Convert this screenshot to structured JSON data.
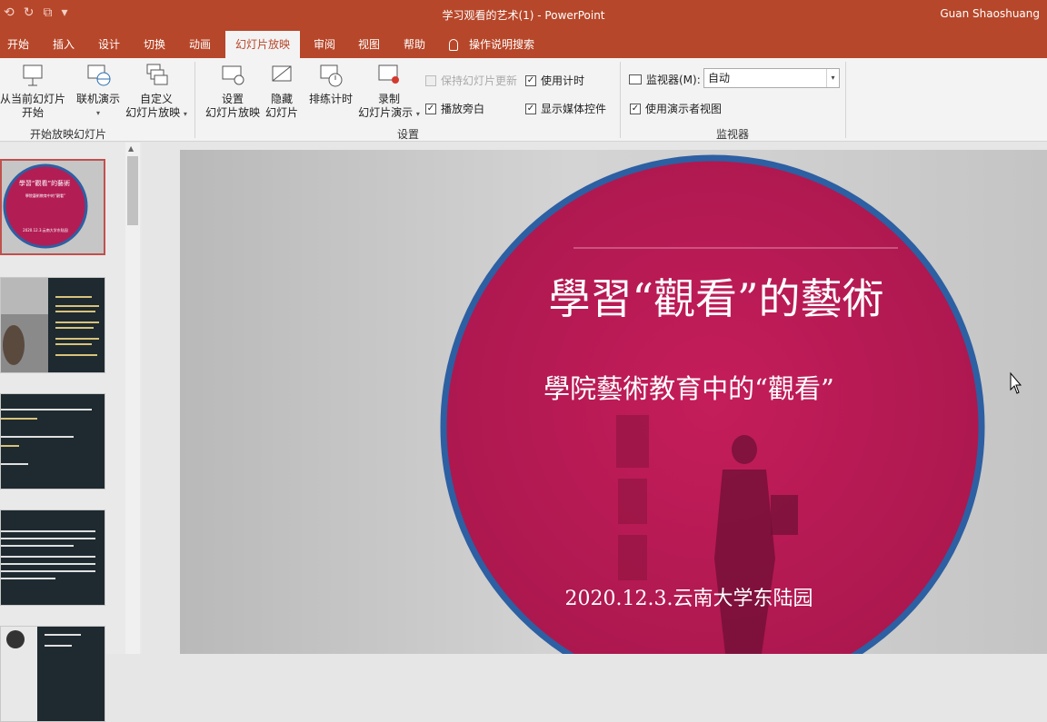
{
  "titlebar": {
    "doc_title": "学习观看的艺术(1)  -  PowerPoint",
    "user": "Guan Shaoshuang",
    "qat": [
      "⟲",
      "↻",
      "⧉",
      "▾"
    ]
  },
  "tabs": [
    "开始",
    "插入",
    "设计",
    "切换",
    "动画",
    "幻灯片放映",
    "审阅",
    "视图",
    "帮助",
    "操作说明搜索"
  ],
  "ribbon": {
    "start": {
      "from_current": "从当前幻灯片",
      "from_current_2": "开始",
      "online": "联机演示",
      "custom": "自定义",
      "custom_2": "幻灯片放映",
      "group_label": "开始放映幻灯片"
    },
    "setup": {
      "setup_show": "设置",
      "setup_show_2": "幻灯片放映",
      "hide": "隐藏",
      "hide_2": "幻灯片",
      "rehearse": "排练计时",
      "record": "录制",
      "record_2": "幻灯片演示",
      "keep_updated": "保持幻灯片更新",
      "play_narrations": "播放旁白",
      "use_timings": "使用计时",
      "show_media": "显示媒体控件",
      "group_label": "设置"
    },
    "monitors": {
      "monitor_label": "监视器(M):",
      "monitor_value": "自动",
      "presenter_view": "使用演示者视图",
      "group_label": "监视器"
    }
  },
  "slide": {
    "title": "學習“觀看”的藝術",
    "subtitle": "學院藝術教育中的“觀看”",
    "date": "2020.12.3.云南大学东陆园"
  },
  "thumbnails": [
    {
      "title": "學習“觀看”的藝術",
      "subtitle": "學院藝術教育中的“觀看”",
      "date": "2020.12.3.云南大学东陆园"
    }
  ],
  "colors": {
    "accent": "#b7472a",
    "circle": "#c01d58",
    "rim": "#2d5fa3",
    "thumb_bg": "#1e2a30"
  }
}
